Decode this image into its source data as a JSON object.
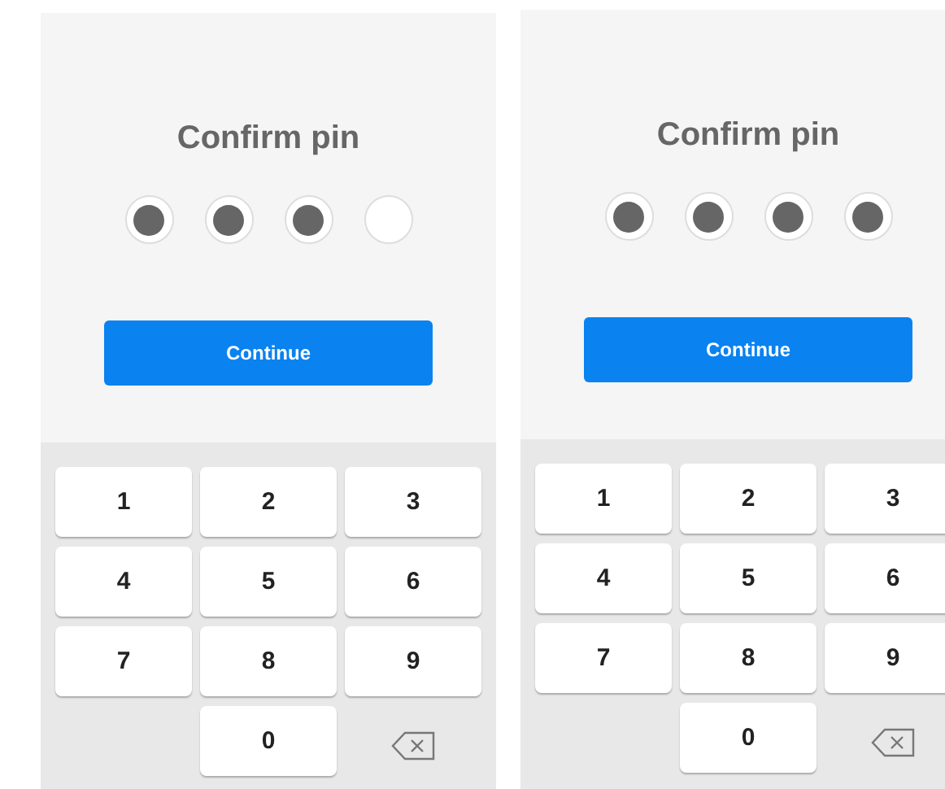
{
  "screens": [
    {
      "title": "Confirm pin",
      "pin_dots": [
        {
          "filled": true
        },
        {
          "filled": true
        },
        {
          "filled": true
        },
        {
          "filled": false
        }
      ],
      "button": "Continue",
      "keys": [
        {
          "kind": "digit",
          "label": "1"
        },
        {
          "kind": "digit",
          "label": "2"
        },
        {
          "kind": "digit",
          "label": "3"
        },
        {
          "kind": "digit",
          "label": "4"
        },
        {
          "kind": "digit",
          "label": "5"
        },
        {
          "kind": "digit",
          "label": "6"
        },
        {
          "kind": "digit",
          "label": "7"
        },
        {
          "kind": "digit",
          "label": "8"
        },
        {
          "kind": "digit",
          "label": "9"
        },
        {
          "kind": "blank"
        },
        {
          "kind": "digit",
          "label": "0"
        },
        {
          "kind": "backspace"
        }
      ]
    },
    {
      "title": "Confirm pin",
      "pin_dots": [
        {
          "filled": true
        },
        {
          "filled": true
        },
        {
          "filled": true
        },
        {
          "filled": true
        }
      ],
      "button": "Continue",
      "keys": [
        {
          "kind": "digit",
          "label": "1"
        },
        {
          "kind": "digit",
          "label": "2"
        },
        {
          "kind": "digit",
          "label": "3"
        },
        {
          "kind": "digit",
          "label": "4"
        },
        {
          "kind": "digit",
          "label": "5"
        },
        {
          "kind": "digit",
          "label": "6"
        },
        {
          "kind": "digit",
          "label": "7"
        },
        {
          "kind": "digit",
          "label": "8"
        },
        {
          "kind": "digit",
          "label": "9"
        },
        {
          "kind": "blank"
        },
        {
          "kind": "digit",
          "label": "0"
        },
        {
          "kind": "backspace"
        }
      ]
    }
  ]
}
